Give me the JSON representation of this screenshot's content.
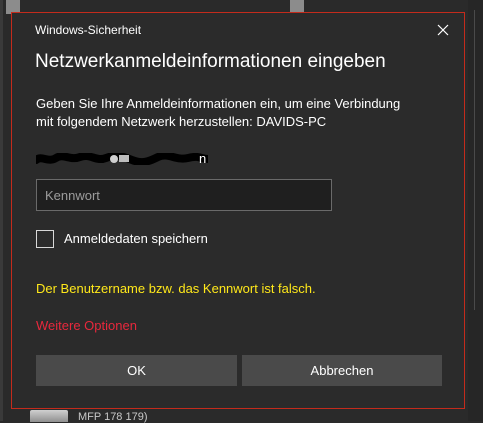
{
  "background": {
    "partial_item_text": "MFP 178 179)"
  },
  "dialog": {
    "window_title": "Windows-Sicherheit",
    "close_icon": "close-icon",
    "heading": "Netzwerkanmeldeinformationen eingeben",
    "message_line1": "Geben Sie Ihre Anmeldeinformationen ein, um eine Verbindung",
    "message_line2": "mit folgendem Netzwerk herzustellen: DAVIDS-PC",
    "username_visible_suffix": "n",
    "password": {
      "value": "",
      "placeholder": "Kennwort"
    },
    "remember": {
      "label": "Anmeldedaten speichern",
      "checked": false
    },
    "error_message": "Der Benutzername bzw. das Kennwort ist falsch.",
    "more_options_label": "Weitere Optionen",
    "ok_label": "OK",
    "cancel_label": "Abbrechen"
  },
  "colors": {
    "dialog_background": "#2b2b2b",
    "dialog_border": "#c42b1c",
    "error_text": "#ffe81a",
    "link_text": "#e8283c",
    "button_background": "#4a4a4a"
  }
}
